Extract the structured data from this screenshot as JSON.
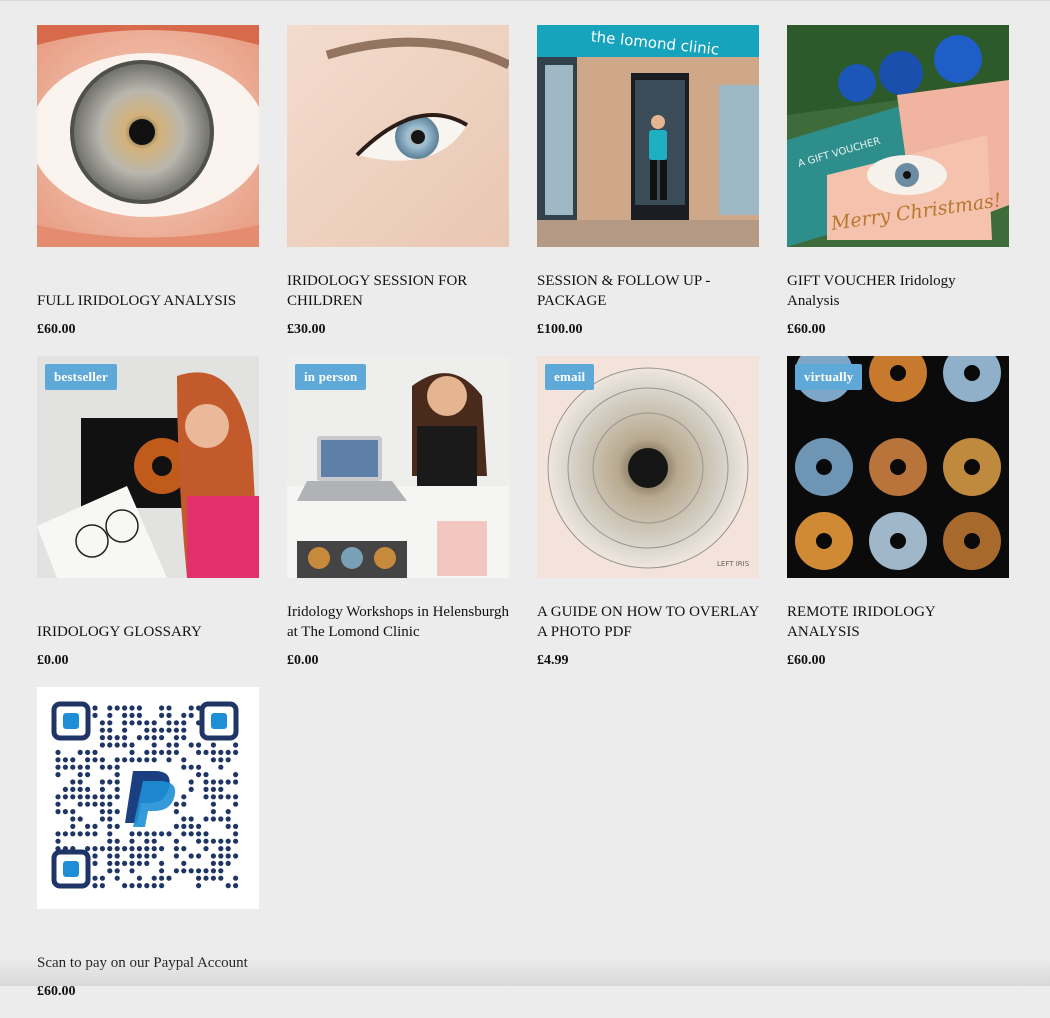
{
  "products": [
    {
      "title": "FULL IRIDOLOGY ANALYSIS",
      "price": "£60.00",
      "badge": "",
      "image": "eye-closeup-grey-iris"
    },
    {
      "title": "IRIDOLOGY SESSION FOR CHILDREN",
      "price": "£30.00",
      "badge": "",
      "image": "eye-side-blue-iris"
    },
    {
      "title": "SESSION & FOLLOW UP - PACKAGE",
      "price": "£100.00",
      "badge": "",
      "image": "lomond-clinic-storefront",
      "sign": "the lomond clinic"
    },
    {
      "title": "GIFT VOUCHER Iridology Analysis",
      "price": "£60.00",
      "badge": "",
      "image": "christmas-gift-voucher",
      "card_text": "Merry Christmas!",
      "voucher_text": "A GIFT VOUCHER"
    },
    {
      "title": "IRIDOLOGY GLOSSARY",
      "price": "£0.00",
      "badge": "bestseller",
      "image": "woman-with-iris-chart"
    },
    {
      "title": "Iridology Workshops in Helensburgh at The Lomond Clinic",
      "price": "£0.00",
      "badge": "in person",
      "image": "woman-at-desk-laptop"
    },
    {
      "title": "A GUIDE ON HOW TO OVERLAY A PHOTO PDF",
      "price": "£4.99",
      "badge": "email",
      "image": "iris-chart-overlay",
      "chart_text": "LEFT IRIS"
    },
    {
      "title": "REMOTE IRIDOLOGY ANALYSIS",
      "price": "£60.00",
      "badge": "virtually",
      "image": "iris-grid-collage"
    },
    {
      "title": "Scan to pay on our Paypal Account",
      "price": "£60.00",
      "badge": "",
      "image": "paypal-qr-code"
    }
  ],
  "colors": {
    "background": "#ececec",
    "badge": "#5ea9d8",
    "qr_navy": "#1f3566",
    "paypal_blue": "#1e8fd6"
  }
}
